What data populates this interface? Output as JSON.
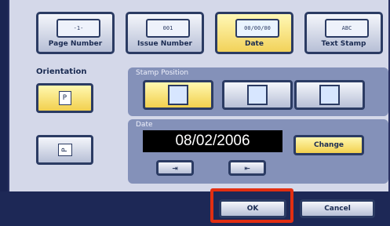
{
  "tabs": [
    {
      "icon_text": "-1-",
      "label": "Page Number"
    },
    {
      "icon_text": "001",
      "label": "Issue Number"
    },
    {
      "icon_text": "00/00/00",
      "label": "Date"
    },
    {
      "icon_text": "ABC",
      "label": "Text Stamp"
    }
  ],
  "selected_tab": "Date",
  "orientation": {
    "label": "Orientation",
    "portrait_glyph": "P",
    "landscape_glyph": "P",
    "selected": "portrait"
  },
  "stamp_position": {
    "label": "Stamp Position",
    "selected_index": 0
  },
  "date": {
    "label": "Date",
    "value": "08/02/2006",
    "change_label": "Change",
    "left_arrow": "⇥",
    "right_arrow": "⇤"
  },
  "footer": {
    "ok_label": "OK",
    "cancel_label": "Cancel"
  },
  "colors": {
    "highlight": "#e22f12",
    "selected": "#f2d04e",
    "panel": "#d4d8e9",
    "frame": "#1a2452"
  }
}
